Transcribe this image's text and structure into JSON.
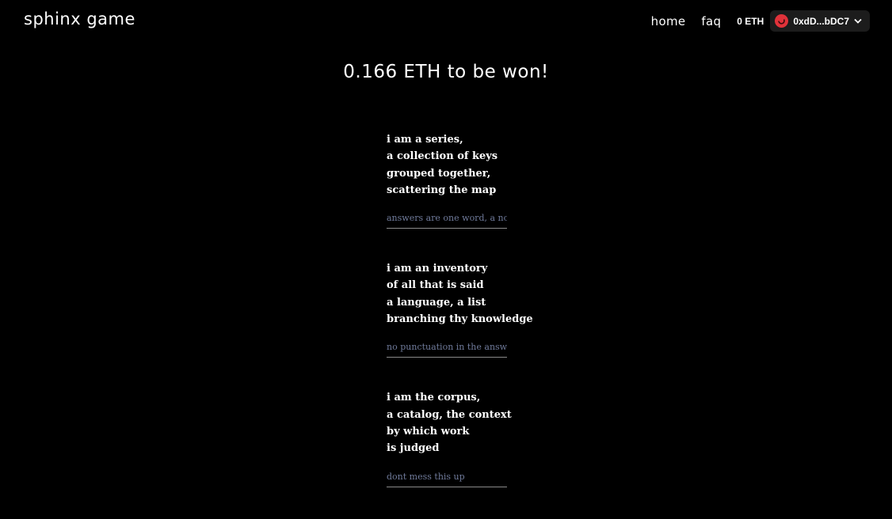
{
  "header": {
    "logo": "sphinx game",
    "nav": {
      "home": "home",
      "faq": "faq"
    },
    "balance": "0 ETH",
    "wallet": {
      "address": "0xdD...bDC7",
      "avatar_color": "#e0323a"
    }
  },
  "prize": {
    "text": "0.166 ETH to be won!"
  },
  "riddles": [
    {
      "lines": [
        "i am a series,",
        "a collection of keys",
        "grouped together,",
        "scattering the map"
      ],
      "placeholder": "answers are one word, a noun"
    },
    {
      "lines": [
        "i am an inventory",
        "of all that is said",
        "a language, a list",
        "branching thy knowledge"
      ],
      "placeholder": "no punctuation in the answers"
    },
    {
      "lines": [
        "i am the corpus,",
        "a catalog, the context",
        "by which work",
        "is judged"
      ],
      "placeholder": "dont mess this up"
    }
  ],
  "colors": {
    "background": "#000000",
    "text": "#ffffff",
    "placeholder": "#6f7a9a",
    "underline": "#8a8a8a",
    "wallet_bg": "#1c1c1c"
  },
  "icons": {
    "avatar": "wallet-avatar-icon",
    "chevron": "chevron-down-icon"
  }
}
